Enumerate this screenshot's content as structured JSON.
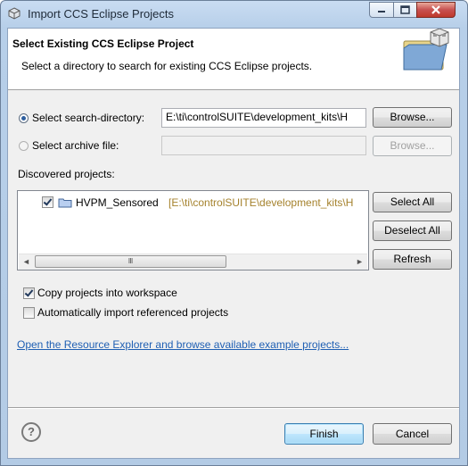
{
  "window": {
    "title": "Import CCS Eclipse Projects",
    "controls": [
      "minimize-icon",
      "maximize-icon",
      "close-icon"
    ]
  },
  "banner": {
    "title": "Select Existing CCS Eclipse Project",
    "subtitle": "Select a directory to search for existing CCS Eclipse projects.",
    "icon": "import-folder-icon"
  },
  "source": {
    "search_dir_label": "Select search-directory:",
    "search_dir_value": "E:\\ti\\controlSUITE\\development_kits\\H",
    "search_dir_selected": true,
    "browse_label": "Browse...",
    "archive_label": "Select archive file:",
    "archive_value": "",
    "archive_selected": false,
    "archive_browse_label": "Browse..."
  },
  "discovered": {
    "label": "Discovered projects:",
    "projects": [
      {
        "name": "HVPM_Sensored",
        "path": "[E:\\ti\\controlSUITE\\development_kits\\H",
        "checked": true
      }
    ],
    "select_all_label": "Select All",
    "deselect_all_label": "Deselect All",
    "refresh_label": "Refresh"
  },
  "options": {
    "copy_label": "Copy projects into workspace",
    "copy_checked": true,
    "auto_import_label": "Automatically import referenced projects",
    "auto_import_checked": false
  },
  "resource_link": "Open the Resource Explorer and browse available example projects...",
  "footer": {
    "finish_label": "Finish",
    "cancel_label": "Cancel",
    "help_symbol": "?"
  },
  "colors": {
    "accent": "#1f5fb3",
    "project_path": "#a5822d"
  }
}
